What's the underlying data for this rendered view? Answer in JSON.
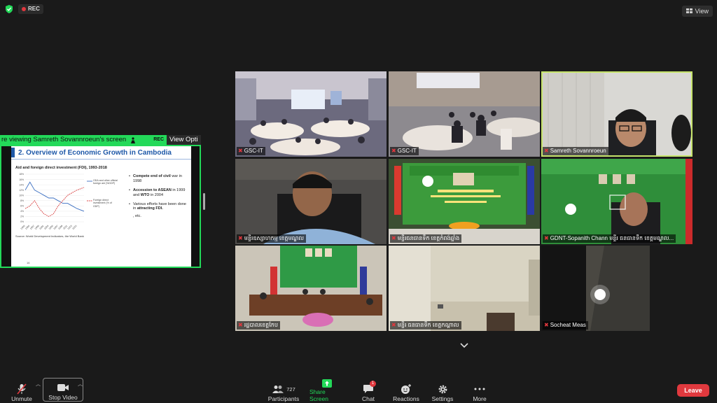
{
  "top": {
    "rec_label": "REC",
    "view_label": "View"
  },
  "share": {
    "banner_text": "re viewing Samreth Sovannroeun's screen",
    "banner_rec": "REC",
    "view_options": "View Opti"
  },
  "slide": {
    "title": "2. Overview of Economic Growth in Cambodia",
    "chart_title": "Aid and foreign direct investment (FDI), 1993-2018",
    "legend_aid": "ODA and other official foreign aid (%GDP)",
    "legend_fdi": "Foreign direct investment (% of GDP)",
    "y_ticks": [
      "18%",
      "16%",
      "14%",
      "12%",
      "10%",
      "8%",
      "6%",
      "4%",
      "2%",
      "0%"
    ],
    "x_ticks": [
      "1993",
      "1995",
      "1997",
      "1999",
      "2001",
      "2003",
      "2005",
      "2007",
      "2009",
      "2011",
      "2013",
      "2015"
    ],
    "bullets": [
      {
        "pre": "Compete end of civil war in 1998"
      },
      {
        "pre": "Accession to ASEAN in 1999 and WTO in 2004"
      },
      {
        "pre": "Various efforts have been done in attracting FDI."
      }
    ],
    "etc": ", etc.",
    "source": "Source: World Development Indicators, the World Bank",
    "page": "16"
  },
  "tiles": [
    {
      "name": "GSC-IT"
    },
    {
      "name": "GSC-IT"
    },
    {
      "name": "Samreth Sovannroeun"
    },
    {
      "name": "មន្ទីរឧស្សាហកម្ម ខេត្តមណ្ឌល"
    },
    {
      "name": "មន្ទីរធនធានទឹក ខេត្តកំពង់ឆ្នាំង"
    },
    {
      "name": "GDNT-Sopanith Chann មន្ទីរ ធនធានទឹក ខេត្តមណ្ឌល..."
    },
    {
      "name": "រដ្ឋបាលខេត្តកែប"
    },
    {
      "name": "មន្ទីរ ធនធានទឹក ខេត្តកណ្ដាល"
    },
    {
      "name": "Socheat Meas"
    }
  ],
  "toolbar": {
    "unmute": "Unmute",
    "stop_video": "Stop Video",
    "participants": "Participants",
    "participants_count": "727",
    "share_screen": "Share Screen",
    "chat": "Chat",
    "chat_badge": "1",
    "reactions": "Reactions",
    "settings": "Settings",
    "more": "More",
    "leave": "Leave"
  },
  "colors": {
    "share_green": "#23d959",
    "leave_red": "#e0393e",
    "active_speaker": "#c6e46b",
    "slide_blue": "#1e58a8"
  },
  "chart_data": {
    "type": "line",
    "title": "Aid and foreign direct investment (FDI), 1993-2018",
    "ylim": [
      0,
      18
    ],
    "x": [
      1993,
      1995,
      1997,
      1999,
      2001,
      2003,
      2005,
      2007,
      2009,
      2011,
      2013,
      2015,
      2018
    ],
    "series": [
      {
        "name": "ODA and other official foreign aid (%GDP)",
        "values": [
          12,
          15,
          12,
          11,
          10,
          9,
          9,
          8,
          7,
          7,
          6,
          5,
          4
        ]
      },
      {
        "name": "Foreign direct investment (% of GDP)",
        "values": [
          5,
          6,
          8,
          5,
          3,
          2,
          3,
          6,
          8,
          10,
          11,
          12,
          13
        ]
      }
    ]
  }
}
